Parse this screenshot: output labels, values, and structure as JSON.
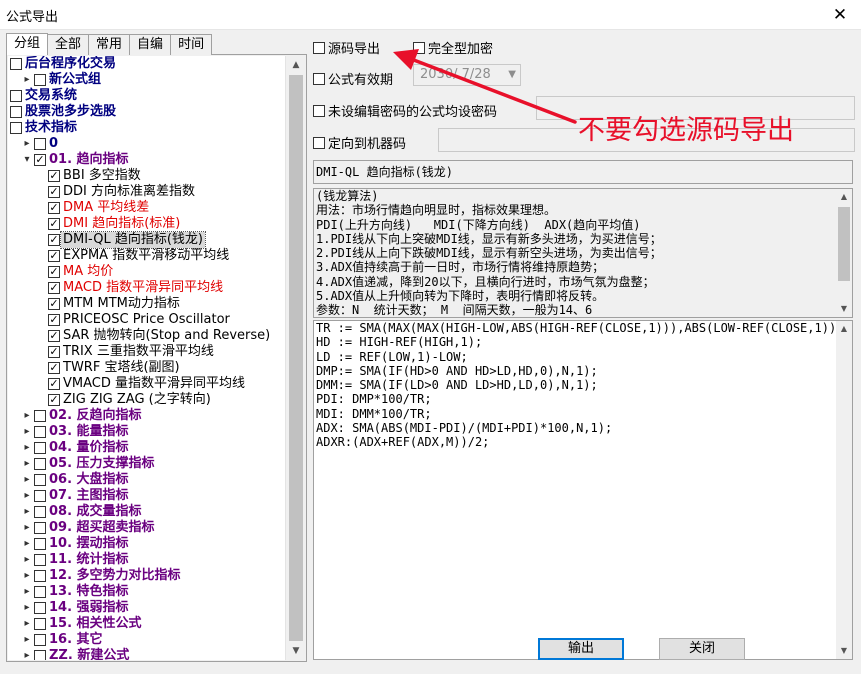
{
  "window": {
    "title": "公式导出",
    "close_glyph": "✕"
  },
  "tabs": [
    {
      "label": "分组",
      "active": true
    },
    {
      "label": "全部",
      "active": false
    },
    {
      "label": "常用",
      "active": false
    },
    {
      "label": "自编",
      "active": false
    },
    {
      "label": "时间",
      "active": false
    }
  ],
  "tree": [
    {
      "level": 0,
      "expander": "",
      "checked": false,
      "label": "后台程序化交易",
      "style": "bold"
    },
    {
      "level": 1,
      "expander": "▸",
      "checked": false,
      "label": "新公式组",
      "style": "bold"
    },
    {
      "level": 0,
      "expander": "",
      "checked": false,
      "label": "交易系统",
      "style": "bold"
    },
    {
      "level": 0,
      "expander": "",
      "checked": false,
      "label": "股票池多步选股",
      "style": "bold"
    },
    {
      "level": 0,
      "expander": "",
      "checked": false,
      "label": "技术指标",
      "style": "bold"
    },
    {
      "level": 1,
      "expander": "▸",
      "checked": false,
      "label": "0",
      "style": "bold"
    },
    {
      "level": 1,
      "expander": "▾",
      "checked": true,
      "label": "01. 趋向指标",
      "style": "purple"
    },
    {
      "level": 2,
      "expander": "",
      "checked": true,
      "label": "BBI 多空指数",
      "style": "normal"
    },
    {
      "level": 2,
      "expander": "",
      "checked": true,
      "label": "DDI 方向标准离差指数",
      "style": "normal"
    },
    {
      "level": 2,
      "expander": "",
      "checked": true,
      "label": "DMA 平均线差",
      "style": "red"
    },
    {
      "level": 2,
      "expander": "",
      "checked": true,
      "label": "DMI 趋向指标(标准)",
      "style": "red"
    },
    {
      "level": 2,
      "expander": "",
      "checked": true,
      "label": "DMI-QL 趋向指标(钱龙)",
      "style": "selected"
    },
    {
      "level": 2,
      "expander": "",
      "checked": true,
      "label": "EXPMA 指数平滑移动平均线",
      "style": "normal"
    },
    {
      "level": 2,
      "expander": "",
      "checked": true,
      "label": "MA 均价",
      "style": "red"
    },
    {
      "level": 2,
      "expander": "",
      "checked": true,
      "label": "MACD 指数平滑异同平均线",
      "style": "red"
    },
    {
      "level": 2,
      "expander": "",
      "checked": true,
      "label": "MTM MTM动力指标",
      "style": "normal"
    },
    {
      "level": 2,
      "expander": "",
      "checked": true,
      "label": "PRICEOSC Price Oscillator",
      "style": "normal"
    },
    {
      "level": 2,
      "expander": "",
      "checked": true,
      "label": "SAR 抛物转向(Stop and Reverse)",
      "style": "normal"
    },
    {
      "level": 2,
      "expander": "",
      "checked": true,
      "label": "TRIX 三重指数平滑平均线",
      "style": "normal"
    },
    {
      "level": 2,
      "expander": "",
      "checked": true,
      "label": "TWRF 宝塔线(副图)",
      "style": "normal"
    },
    {
      "level": 2,
      "expander": "",
      "checked": true,
      "label": "VMACD 量指数平滑异同平均线",
      "style": "normal"
    },
    {
      "level": 2,
      "expander": "",
      "checked": true,
      "label": "ZIG ZIG ZAG (之字转向)",
      "style": "normal"
    },
    {
      "level": 1,
      "expander": "▸",
      "checked": false,
      "label": "02. 反趋向指标",
      "style": "purple"
    },
    {
      "level": 1,
      "expander": "▸",
      "checked": false,
      "label": "03. 能量指标",
      "style": "purple"
    },
    {
      "level": 1,
      "expander": "▸",
      "checked": false,
      "label": "04. 量价指标",
      "style": "purple"
    },
    {
      "level": 1,
      "expander": "▸",
      "checked": false,
      "label": "05. 压力支撑指标",
      "style": "purple"
    },
    {
      "level": 1,
      "expander": "▸",
      "checked": false,
      "label": "06. 大盘指标",
      "style": "purple"
    },
    {
      "level": 1,
      "expander": "▸",
      "checked": false,
      "label": "07. 主图指标",
      "style": "purple"
    },
    {
      "level": 1,
      "expander": "▸",
      "checked": false,
      "label": "08. 成交量指标",
      "style": "purple"
    },
    {
      "level": 1,
      "expander": "▸",
      "checked": false,
      "label": "09. 超买超卖指标",
      "style": "purple"
    },
    {
      "level": 1,
      "expander": "▸",
      "checked": false,
      "label": "10. 摆动指标",
      "style": "purple"
    },
    {
      "level": 1,
      "expander": "▸",
      "checked": false,
      "label": "11. 统计指标",
      "style": "purple"
    },
    {
      "level": 1,
      "expander": "▸",
      "checked": false,
      "label": "12. 多空势力对比指标",
      "style": "purple"
    },
    {
      "level": 1,
      "expander": "▸",
      "checked": false,
      "label": "13. 特色指标",
      "style": "purple"
    },
    {
      "level": 1,
      "expander": "▸",
      "checked": false,
      "label": "14. 强弱指标",
      "style": "purple"
    },
    {
      "level": 1,
      "expander": "▸",
      "checked": false,
      "label": "15. 相关性公式",
      "style": "purple"
    },
    {
      "level": 1,
      "expander": "▸",
      "checked": false,
      "label": "16. 其它",
      "style": "purple"
    },
    {
      "level": 1,
      "expander": "▸",
      "checked": false,
      "label": "ZZ. 新建公式",
      "style": "purple"
    }
  ],
  "options": {
    "source_export": "源码导出",
    "full_encrypt": "完全型加密",
    "valid_period": "公式有效期",
    "valid_date": "2030/ 7/28",
    "no_password": "未设编辑密码的公式均设密码",
    "bind_machine": "定向到机器码"
  },
  "annotation": "不要勾选源码导出",
  "formula_name": "DMI-QL 趋向指标(钱龙)",
  "description_lines": [
    "(钱龙算法)",
    "用法：市场行情趋向明显时，指标效果理想。",
    "PDI(上升方向线)   MDI(下降方向线)  ADX(趋向平均值)",
    "1.PDI线从下向上突破MDI线，显示有新多头进场，为买进信号；",
    "2.PDI线从上向下跌破MDI线，显示有新空头进场，为卖出信号；",
    "3.ADX值持续高于前一日时，市场行情将维持原趋势；",
    "4.ADX值递减，降到20以下，且横向行进时，市场气氛为盘整；",
    "5.ADX值从上升倾向转为下降时，表明行情即将反转。",
    "参数：N  统计天数； M  间隔天数，一般为14、6"
  ],
  "code_lines": [
    "TR := SMA(MAX(MAX(HIGH-LOW,ABS(HIGH-REF(CLOSE,1))),ABS(LOW-REF(CLOSE,1))),",
    "HD := HIGH-REF(HIGH,1);",
    "LD := REF(LOW,1)-LOW;",
    "DMP:= SMA(IF(HD>0 AND HD>LD,HD,0),N,1);",
    "DMM:= SMA(IF(LD>0 AND LD>HD,LD,0),N,1);",
    "PDI: DMP*100/TR;",
    "MDI: DMM*100/TR;",
    "ADX: SMA(ABS(MDI-PDI)/(MDI+PDI)*100,N,1);",
    "ADXR:(ADX+REF(ADX,M))/2;"
  ],
  "buttons": {
    "export": "输出",
    "close": "关闭"
  },
  "colors": {
    "accent": "#0078d7",
    "annotation": "#e8102a",
    "category": "#6a0080",
    "highlight": "#e00000"
  }
}
